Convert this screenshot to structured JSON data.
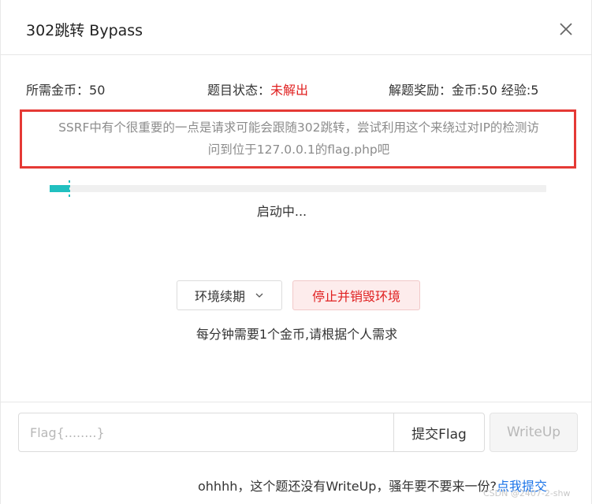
{
  "dialog": {
    "title": "302跳转 Bypass",
    "close_icon": "close-icon"
  },
  "info": {
    "cost_label": "所需金币：",
    "cost_value": "50",
    "status_label": "题目状态：",
    "status_value": "未解出",
    "status_color": "#e02020",
    "reward_label": "解题奖励：",
    "reward_value": "金币:50 经验:5"
  },
  "hint": {
    "line1": "SSRF中有个很重要的一点是请求可能会跟随302跳转，尝试利用这个来绕过对IP的检测访",
    "line2": "问到位于127.0.0.1的flag.php吧",
    "border_color": "#e53935"
  },
  "progress": {
    "fraction": 0.04,
    "color": "#21c0c0",
    "status_text": "启动中..."
  },
  "actions": {
    "renew_label": "环境续期",
    "renew_icon": "chevron-down-icon",
    "stop_label": "停止并销毁环境",
    "cost_note": "每分钟需要1个金币,请根据个人需求"
  },
  "footer": {
    "flag_placeholder": "Flag{........}",
    "flag_value": "",
    "submit_label": "提交Flag",
    "writeup_label": "WriteUp",
    "note_text": "ohhhh，这个题还没有WriteUp，骚年要不要来一份?",
    "note_link": "点我提交",
    "link_color": "#1a73e8"
  },
  "watermark": "CSDN @2407-2-shw"
}
